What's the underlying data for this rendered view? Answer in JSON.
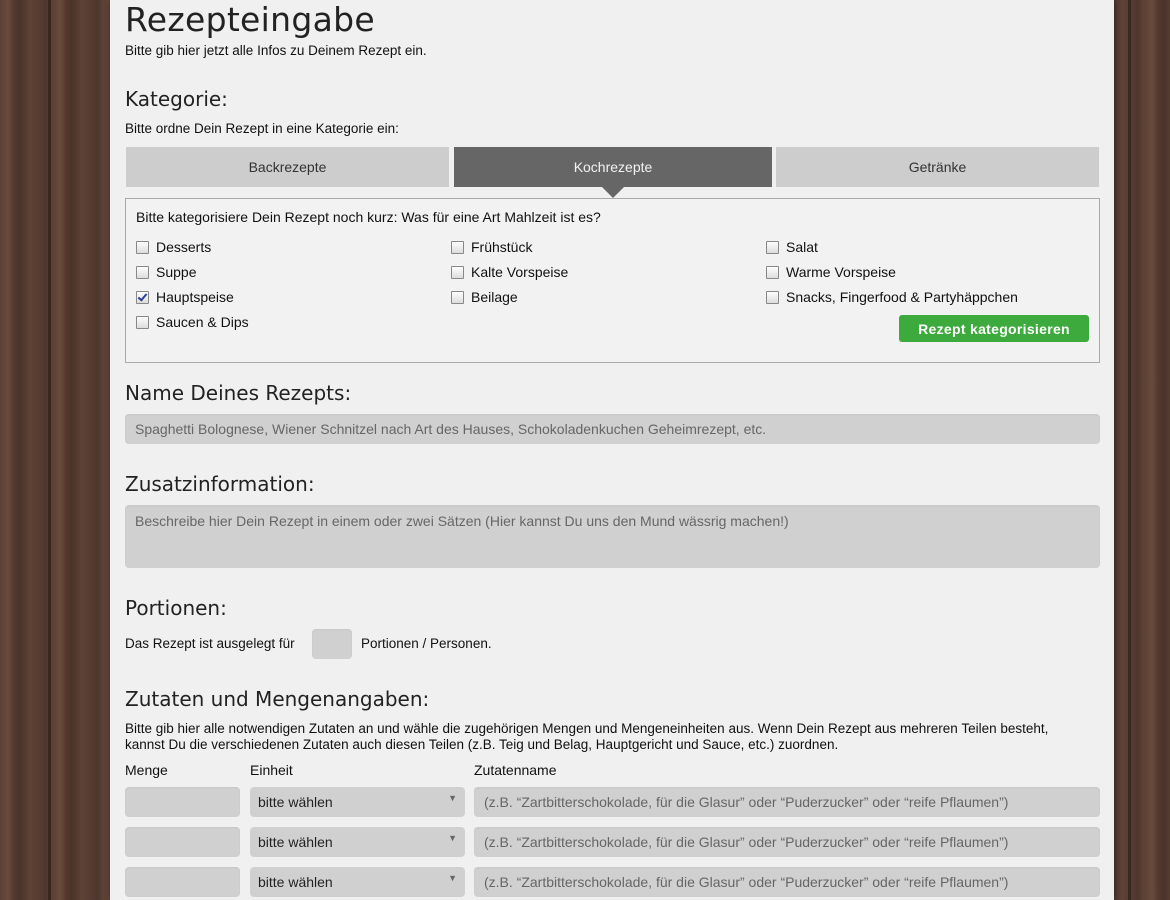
{
  "page": {
    "title": "Rezepteingabe",
    "intro": "Bitte gib hier jetzt alle Infos zu Deinem Rezept ein."
  },
  "kategorie": {
    "heading": "Kategorie:",
    "hint": "Bitte ordne Dein Rezept in eine Kategorie ein:",
    "tabs": [
      "Backrezepte",
      "Kochrezepte",
      "Getränke"
    ],
    "active_tab": "Kochrezepte",
    "question": "Bitte kategorisiere Dein Rezept noch kurz: Was für eine Art Mahlzeit ist es?",
    "options": {
      "desserts": {
        "label": "Desserts",
        "checked": false
      },
      "suppe": {
        "label": "Suppe",
        "checked": false
      },
      "hauptspeise": {
        "label": "Hauptspeise",
        "checked": true
      },
      "saucen": {
        "label": "Saucen & Dips",
        "checked": false
      },
      "fruehstueck": {
        "label": "Frühstück",
        "checked": false
      },
      "kalte": {
        "label": "Kalte Vorspeise",
        "checked": false
      },
      "beilage": {
        "label": "Beilage",
        "checked": false
      },
      "salat": {
        "label": "Salat",
        "checked": false
      },
      "warme": {
        "label": "Warme Vorspeise",
        "checked": false
      },
      "snacks": {
        "label": "Snacks, Fingerfood & Partyhäppchen",
        "checked": false
      }
    },
    "button": "Rezept kategorisieren"
  },
  "name": {
    "heading": "Name Deines Rezepts:",
    "placeholder": "Spaghetti Bolognese, Wiener Schnitzel nach Art des Hauses, Schokoladenkuchen Geheimrezept, etc."
  },
  "zusatz": {
    "heading": "Zusatzinformation:",
    "placeholder": "Beschreibe hier Dein Rezept in einem oder zwei Sätzen (Hier kannst Du uns den Mund wässrig machen!)"
  },
  "portionen": {
    "heading": "Portionen:",
    "before": "Das Rezept ist ausgelegt für",
    "after": "Portionen / Personen.",
    "value": ""
  },
  "zutaten": {
    "heading": "Zutaten und Mengenangaben:",
    "hint_line1": "Bitte gib hier alle notwendigen Zutaten an und wähle die zugehörigen Mengen und Mengeneinheiten aus. Wenn Dein Rezept aus mehreren Teilen besteht,",
    "hint_line2": "kannst Du die verschiedenen Zutaten auch diesen Teilen (z.B. Teig und Belag, Hauptgericht und Sauce, etc.) zuordnen.",
    "col_menge": "Menge",
    "col_einheit": "Einheit",
    "col_name": "Zutatenname",
    "rows": [
      {
        "menge": "",
        "einheit": "bitte wählen",
        "name_placeholder": "(z.B. “Zartbitterschokolade, für die Glasur” oder “Puderzucker” oder “reife Pflaumen”)"
      },
      {
        "menge": "",
        "einheit": "bitte wählen",
        "name_placeholder": "(z.B. “Zartbitterschokolade, für die Glasur” oder “Puderzucker” oder “reife Pflaumen”)"
      },
      {
        "menge": "",
        "einheit": "bitte wählen",
        "name_placeholder": "(z.B. “Zartbitterschokolade, für die Glasur” oder “Puderzucker” oder “reife Pflaumen”)"
      }
    ]
  },
  "icons": {
    "checkbox": "checkbox-icon",
    "caret": "caret-down-icon"
  }
}
